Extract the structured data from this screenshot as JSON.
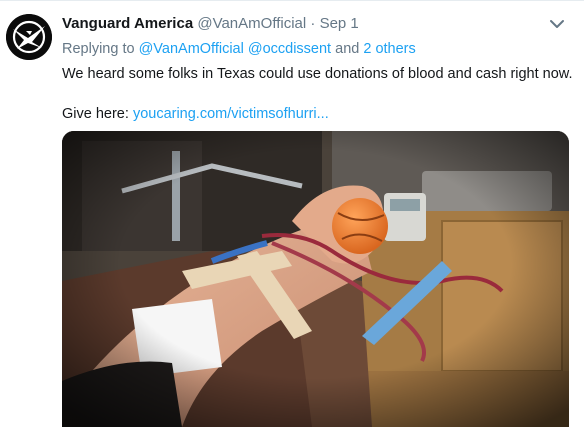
{
  "tweet": {
    "display_name": "Vanguard America",
    "handle": "@VanAmOfficial",
    "separator": "·",
    "date": "Sep 1",
    "reply_prefix": "Replying to",
    "reply_mention_1": "@VanAmOfficial",
    "reply_mention_2": "@occdissent",
    "reply_and": "and",
    "reply_others": "2 others",
    "text": "We heard some folks in Texas could use donations of blood and cash right now.",
    "give_label": "Give here:",
    "link": "youcaring.com/victimsofhurri..."
  },
  "icons": {
    "avatar": "eagle-logo",
    "menu": "chevron-down-icon",
    "media": "blood-donation-photo"
  },
  "colors": {
    "name": "#14171a",
    "secondary": "#657786",
    "link": "#1da1f2",
    "avatar_bg": "#0b0b0b"
  }
}
